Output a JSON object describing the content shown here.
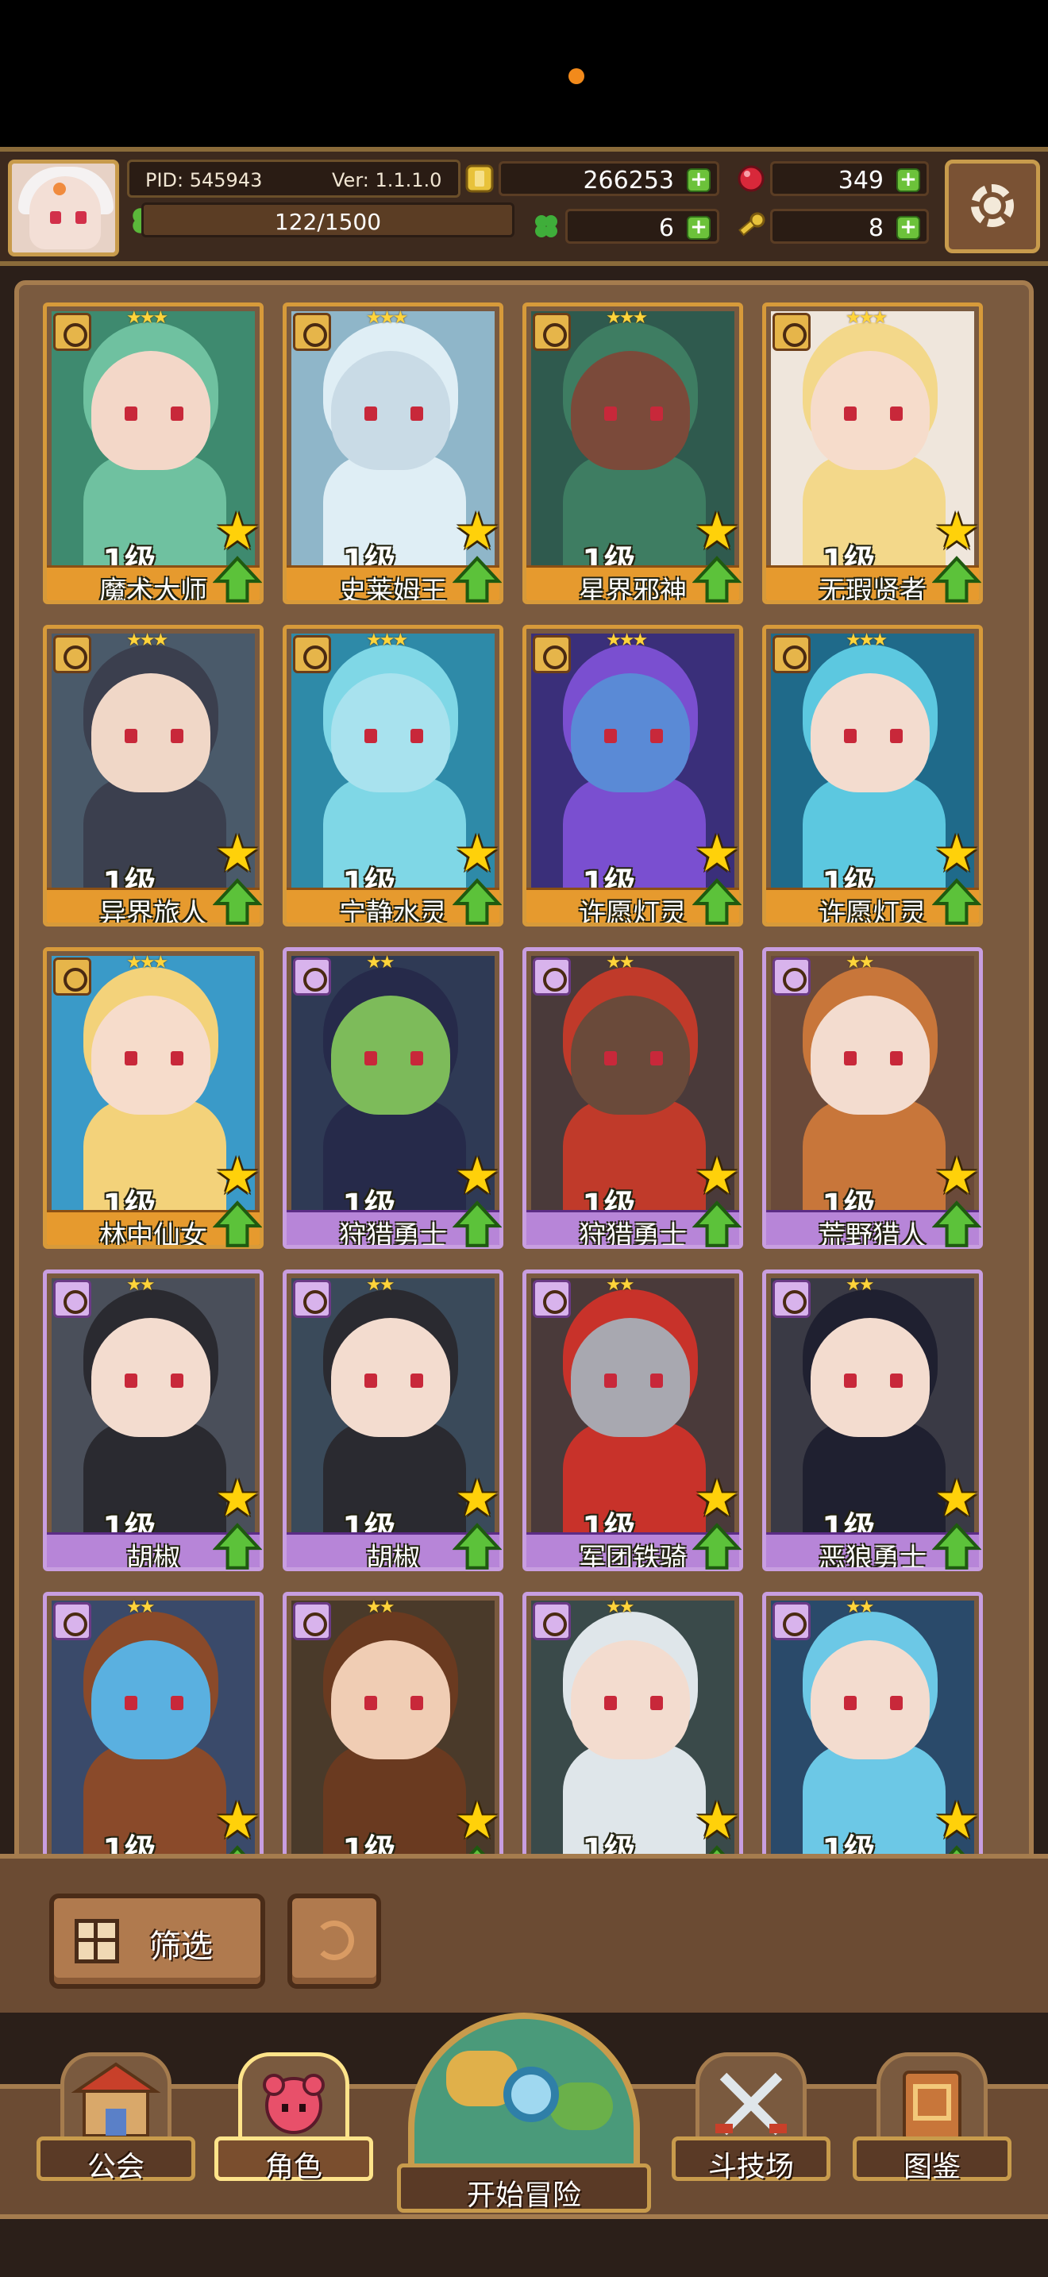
{
  "header": {
    "pid": "PID: 545943",
    "version": "Ver: 1.1.1.0",
    "exp": "122/1500",
    "coins": "266253",
    "gems": "349",
    "clovers": "6",
    "keys": "8"
  },
  "cards": [
    {
      "level": "1级",
      "name": "魔术大师",
      "stars": "★★★",
      "rarity": "gold",
      "theme": "#3e8a6f",
      "hair": "#6fc1a0",
      "skin": "#f3d7c8"
    },
    {
      "level": "1级",
      "name": "史莱姆王",
      "stars": "★★★",
      "rarity": "gold",
      "theme": "#8fb6c9",
      "hair": "#dfeef5",
      "skin": "#c9dbe6"
    },
    {
      "level": "1级",
      "name": "星界邪神",
      "stars": "★★★",
      "rarity": "gold",
      "theme": "#2f5a4e",
      "hair": "#3e7d62",
      "skin": "#7b4a3a"
    },
    {
      "level": "1级",
      "name": "无瑕贤者",
      "stars": "★★★",
      "rarity": "gold",
      "theme": "#efe6dc",
      "hair": "#f3d88a",
      "skin": "#f6dccb"
    },
    {
      "level": "1级",
      "name": "异界旅人",
      "stars": "★★★",
      "rarity": "gold",
      "theme": "#4a5a6a",
      "hair": "#3b3f4e",
      "skin": "#f0d7c7"
    },
    {
      "level": "1级",
      "name": "宁静水灵",
      "stars": "★★★",
      "rarity": "gold",
      "theme": "#2e8aa8",
      "hair": "#7fd7e6",
      "skin": "#a8e2ee"
    },
    {
      "level": "1级",
      "name": "许愿灯灵",
      "stars": "★★★",
      "rarity": "gold",
      "theme": "#3a2f7a",
      "hair": "#7a4fd0",
      "skin": "#5a8ad6"
    },
    {
      "level": "1级",
      "name": "许愿灯灵",
      "stars": "★★★",
      "rarity": "gold",
      "theme": "#1f6a8a",
      "hair": "#5cc8e0",
      "skin": "#f3dccf"
    },
    {
      "level": "1级",
      "name": "林中仙女",
      "stars": "★★★",
      "rarity": "gold",
      "theme": "#3a9ac8",
      "hair": "#f3d27a",
      "skin": "#f6dccb"
    },
    {
      "level": "1级",
      "name": "狩猎勇士",
      "stars": "★★",
      "rarity": "purple",
      "theme": "#2f3a55",
      "hair": "#262a4a",
      "skin": "#7dbb5a"
    },
    {
      "level": "1级",
      "name": "狩猎勇士",
      "stars": "★★",
      "rarity": "purple",
      "theme": "#4a3a3a",
      "hair": "#c03a2a",
      "skin": "#6a4a3a"
    },
    {
      "level": "1级",
      "name": "荒野猎人",
      "stars": "★★",
      "rarity": "purple",
      "theme": "#6a4a3a",
      "hair": "#c8763a",
      "skin": "#f3dccf"
    },
    {
      "level": "1级",
      "name": "胡椒",
      "stars": "★★",
      "rarity": "purple",
      "theme": "#4a4f5a",
      "hair": "#2a2a30",
      "skin": "#f3dccf"
    },
    {
      "level": "1级",
      "name": "胡椒",
      "stars": "★★",
      "rarity": "purple",
      "theme": "#3a4a5a",
      "hair": "#2a2a30",
      "skin": "#f3dccf"
    },
    {
      "level": "1级",
      "name": "军团铁骑",
      "stars": "★★",
      "rarity": "purple",
      "theme": "#4a3a3a",
      "hair": "#c8322a",
      "skin": "#a8a8b0"
    },
    {
      "level": "1级",
      "name": "恶狼勇士",
      "stars": "★★",
      "rarity": "purple",
      "theme": "#3a3a45",
      "hair": "#1f2030",
      "skin": "#f3dccf"
    },
    {
      "level": "1级",
      "name": "",
      "stars": "★★",
      "rarity": "purple",
      "theme": "#3a4a6a",
      "hair": "#8a4a2a",
      "skin": "#5ab0e0"
    },
    {
      "level": "1级",
      "name": "",
      "stars": "★★",
      "rarity": "purple",
      "theme": "#4a3a2a",
      "hair": "#6a3a20",
      "skin": "#f0cdb4"
    },
    {
      "level": "1级",
      "name": "",
      "stars": "★★",
      "rarity": "purple",
      "theme": "#3a4a4a",
      "hair": "#dfe6ea",
      "skin": "#f3dccf"
    },
    {
      "level": "1级",
      "name": "",
      "stars": "★★",
      "rarity": "purple",
      "theme": "#2a4a6a",
      "hair": "#6cc8e6",
      "skin": "#f3dccf"
    }
  ],
  "filter": {
    "label": "筛选"
  },
  "nav": {
    "guild": "公会",
    "character": "角色",
    "adventure": "开始冒险",
    "arena": "斗技场",
    "codex": "图鉴"
  },
  "colors": {
    "accent_gold": "#d79a3a",
    "accent_purple": "#c89ee0",
    "plus_green": "#6cc23a"
  }
}
